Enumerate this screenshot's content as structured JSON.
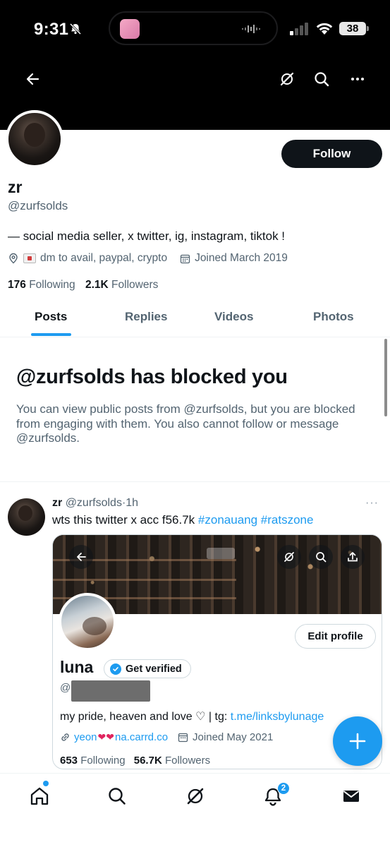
{
  "status_bar": {
    "time": "9:31",
    "battery": "38",
    "icons": [
      "bell-off-icon",
      "signal-icon",
      "wifi-icon",
      "battery-icon"
    ]
  },
  "header": {
    "icons": [
      "back-arrow-icon",
      "grok-icon",
      "search-icon",
      "more-icon"
    ]
  },
  "profile": {
    "display_name": "zr",
    "handle": "@zurfsolds",
    "follow_label": "Follow",
    "bio": "— social media seller, x twitter, ig, instagram, tiktok !",
    "location": "dm to avail, paypal, crypto",
    "joined": "Joined March 2019",
    "following_count": "176",
    "following_label": "Following",
    "followers_count": "2.1K",
    "followers_label": "Followers"
  },
  "tabs": [
    {
      "label": "Posts",
      "active": true
    },
    {
      "label": "Replies",
      "active": false
    },
    {
      "label": "Videos",
      "active": false
    },
    {
      "label": "Photos",
      "active": false
    }
  ],
  "blocked": {
    "title": "@zurfsolds has blocked you",
    "description": "You can view public posts from @zurfsolds, but you are blocked from engaging with them. You also cannot follow or message @zurfsolds."
  },
  "post": {
    "name": "zr",
    "handle": "@zurfsolds",
    "separator": "·",
    "time": "1h",
    "more": "···",
    "text": "wts this twitter x acc f56.7k",
    "hashtags": [
      "#zonauang",
      "#ratszone"
    ],
    "media": {
      "edit_profile_label": "Edit profile",
      "name": "luna",
      "get_verified_label": "Get verified",
      "handle_prefix": "@",
      "bio": "my pride, heaven and love ♡ | tg: ",
      "bio_link": "t.me/linksbylunage",
      "link_start": "yeon",
      "link_end": "na.carrd.co",
      "joined": "Joined May 2021",
      "following_count": "653",
      "following_label": "Following",
      "followers_count": "56.7K",
      "followers_label": "Followers"
    }
  },
  "bottom_nav": {
    "items": [
      "home-icon",
      "search-icon",
      "grok-icon",
      "notifications-icon",
      "messages-icon"
    ],
    "notification_count": "2"
  },
  "colors": {
    "accent": "#1d9bf0",
    "text_primary": "#0f1419",
    "text_secondary": "#536471",
    "border": "#cfd9de"
  }
}
